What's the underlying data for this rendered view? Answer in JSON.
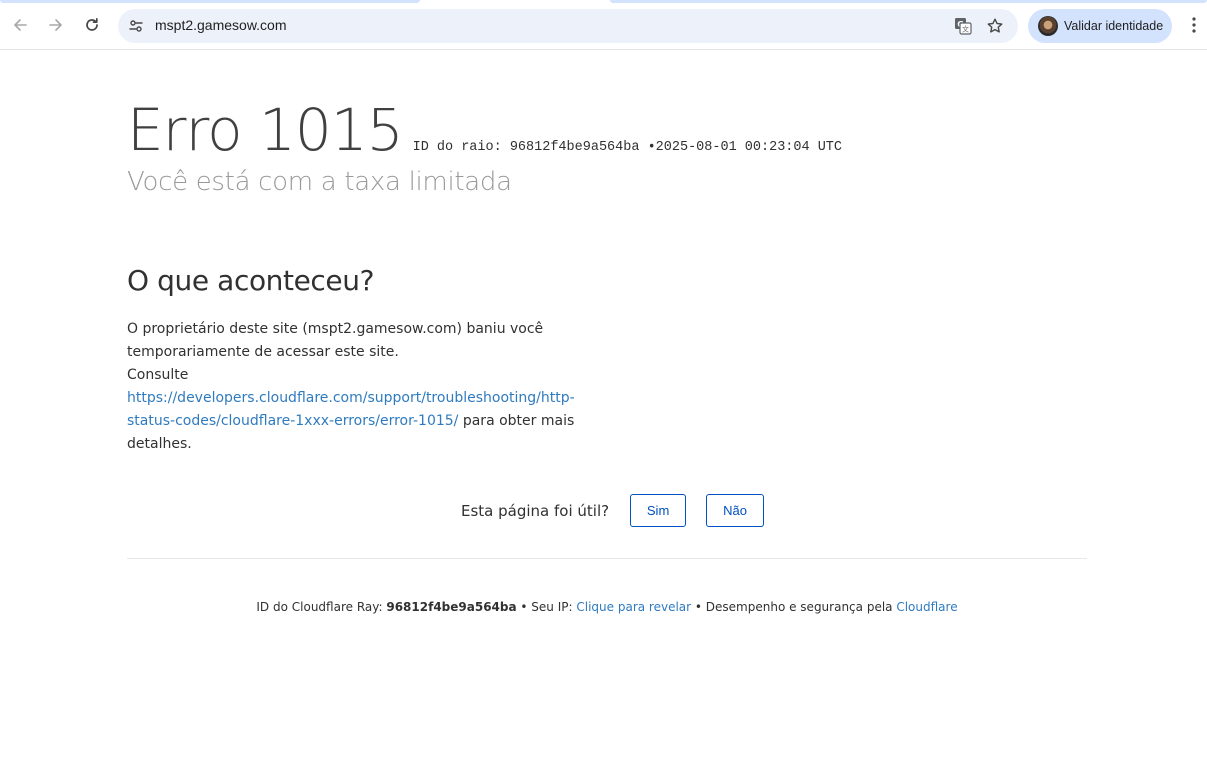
{
  "browser": {
    "url": "mspt2.gamesow.com",
    "profile_button_label": "Validar identidade",
    "icons": {
      "back": "arrow-left-icon",
      "forward": "arrow-right-icon",
      "reload": "reload-icon",
      "site_info": "tune-icon",
      "translate": "translate-icon",
      "bookmark": "star-icon",
      "menu": "kebab-menu-icon"
    },
    "colors": {
      "omnibox_bg": "#edf2fa",
      "profile_pill_bg": "#d3e3fd"
    }
  },
  "error": {
    "title": "Erro 1015",
    "ray_label": "ID do raio:",
    "ray_id": "96812f4be9a564ba",
    "separator": "•",
    "timestamp": "2025-08-01 00:23:04 UTC",
    "subtitle": "Você está com a taxa limitada"
  },
  "what_happened": {
    "title": "O que aconteceu?",
    "paragraph1": "O proprietário deste site (mspt2.gamesow.com) baniu você temporariamente de acessar este site.",
    "consult": "Consulte",
    "link": "https://developers.cloudflare.com/support/troubleshooting/http-status-codes/cloudflare-1xxx-errors/error-1015/",
    "link_suffix": " para obter mais detalhes."
  },
  "feedback": {
    "question": "Esta página foi útil?",
    "yes": "Sim",
    "no": "Não"
  },
  "footer": {
    "ray_label": "ID do Cloudflare Ray:",
    "ray_id": "96812f4be9a564ba",
    "sep1": " • ",
    "ip_label": "Seu IP:",
    "ip_link": "Clique para revelar",
    "sep2": " • ",
    "perf_label": "Desempenho e segurança pela",
    "cloudflare_link": "Cloudflare"
  },
  "colors": {
    "link": "#2f7bbf",
    "button": "#0051c3",
    "subtitle": "#999999"
  }
}
